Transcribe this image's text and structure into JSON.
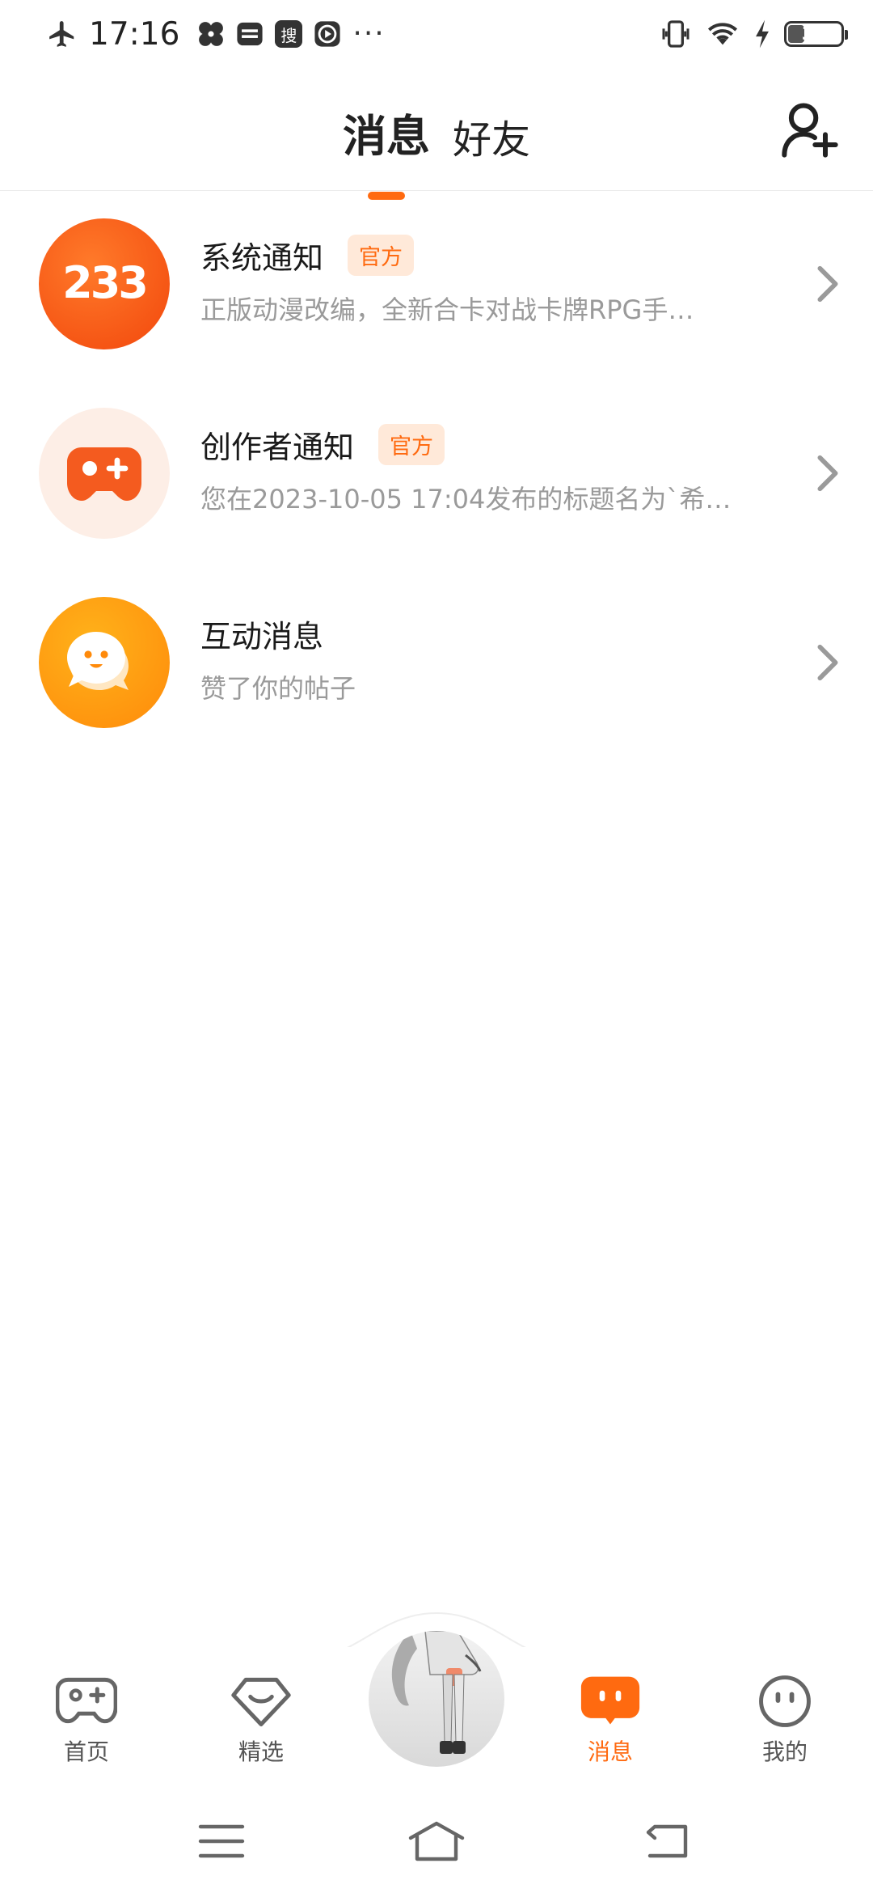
{
  "status_bar": {
    "time": "17:16",
    "app_icon_search": "搜",
    "more": "···",
    "battery": "31",
    "battery_level": 0.31
  },
  "header": {
    "tabs": [
      {
        "label": "消息",
        "active": true
      },
      {
        "label": "好友",
        "active": false
      }
    ],
    "accent_color": "#ff6a10"
  },
  "messages": [
    {
      "title": "系统通知",
      "badge": "官方",
      "subtitle": "正版动漫改编，全新合卡对战卡牌RPG手…",
      "avatar": "233-logo",
      "avatar_text": "233"
    },
    {
      "title": "创作者通知",
      "badge": "官方",
      "subtitle": "您在2023-10-05 17:04发布的标题名为`希…",
      "avatar": "gamepad-icon"
    },
    {
      "title": "互动消息",
      "subtitle": "赞了你的帖子",
      "avatar": "chat-smile-icon"
    }
  ],
  "bottom_nav": {
    "items": [
      {
        "label": "首页",
        "icon": "gamepad-icon"
      },
      {
        "label": "精选",
        "icon": "diamond-smile-icon"
      },
      {
        "label": "消息",
        "icon": "message-icon",
        "active": true
      },
      {
        "label": "我的",
        "icon": "face-icon"
      }
    ]
  }
}
